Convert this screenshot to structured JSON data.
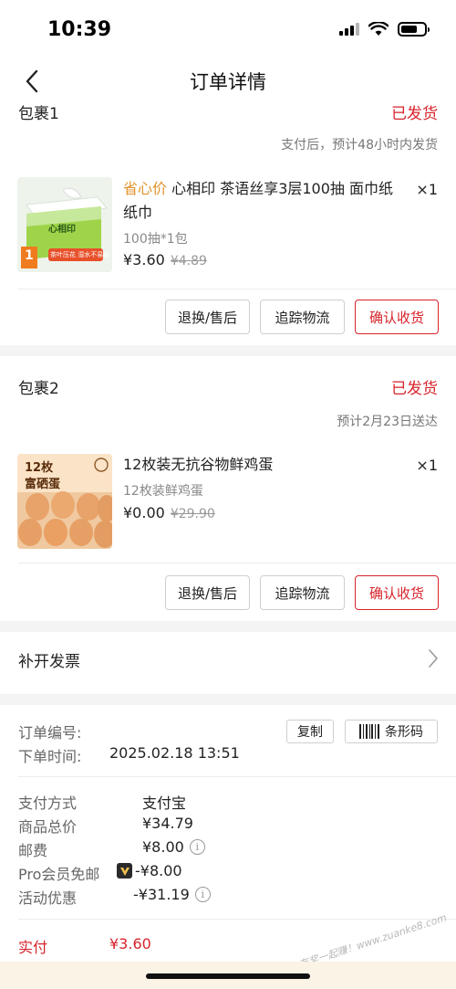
{
  "status_bar": {
    "time": "10:39"
  },
  "nav": {
    "title": "订单详情"
  },
  "package1": {
    "name": "包裹1",
    "status": "已发货",
    "eta": "支付后，预计48小时内发货",
    "product": {
      "tag": "省心价",
      "title": "心相印 茶语丝享3层100抽 面巾纸纸巾",
      "qty": "×1",
      "spec": "100抽*1包",
      "price": "¥3.60",
      "old_price": "¥4.89",
      "image_brand": "心相印",
      "image_badge": "1",
      "image_slogan": "茶叶压花 湿水不易破"
    },
    "actions": [
      "退换/售后",
      "追踪物流",
      "确认收货"
    ]
  },
  "package2": {
    "name": "包裹2",
    "status": "已发货",
    "eta": "预计2月23日送达",
    "product": {
      "title": "12枚装无抗谷物鲜鸡蛋",
      "qty": "×1",
      "spec": "12枚装鲜鸡蛋",
      "price": "¥0.00",
      "old_price": "¥29.90",
      "image_count": "12枚",
      "image_name": "富硒蛋"
    },
    "actions": [
      "退换/售后",
      "追踪物流",
      "确认收货"
    ]
  },
  "invoice": {
    "label": "补开发票"
  },
  "order_info": {
    "number_label": "订单编号:",
    "copy_label": "复制",
    "barcode_label": "条形码",
    "time_label": "下单时间:",
    "time_value": "2025.02.18 13:51"
  },
  "payment": {
    "method_label": "支付方式",
    "method_value": "支付宝",
    "total_label": "商品总价",
    "total_value": "¥34.79",
    "shipping_label": "邮费",
    "shipping_value": "¥8.00",
    "pro_label": "Pro会员免邮",
    "pro_value": "-¥8.00",
    "promo_label": "活动优惠",
    "promo_value": "-¥31.19",
    "paid_label": "实付",
    "paid_value": "¥3.60"
  },
  "watermark": "赚客吧，有奖一起赚！www.zuanke8.com",
  "colors": {
    "accent_red": "#d7232b",
    "tag_orange": "#e0922a",
    "page_bg": "#f4f4f4"
  }
}
